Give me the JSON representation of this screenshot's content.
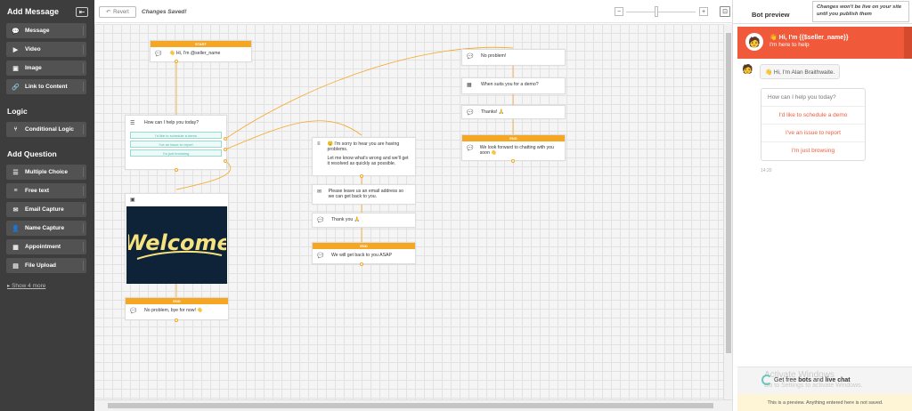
{
  "sidebar": {
    "add_message_title": "Add Message",
    "message_items": [
      {
        "label": "Message",
        "icon": "chat-icon"
      },
      {
        "label": "Video",
        "icon": "video-icon"
      },
      {
        "label": "Image",
        "icon": "image-icon"
      },
      {
        "label": "Link to Content",
        "icon": "link-icon"
      }
    ],
    "logic_title": "Logic",
    "logic_items": [
      {
        "label": "Conditional Logic",
        "icon": "branch-icon"
      }
    ],
    "add_question_title": "Add Question",
    "question_items": [
      {
        "label": "Multiple Choice",
        "icon": "list-icon"
      },
      {
        "label": "Free text",
        "icon": "text-icon"
      },
      {
        "label": "Email Capture",
        "icon": "envelope-icon"
      },
      {
        "label": "Name Capture",
        "icon": "user-icon"
      },
      {
        "label": "Appointment",
        "icon": "calendar-icon"
      },
      {
        "label": "File Upload",
        "icon": "file-icon"
      }
    ],
    "show_more": "Show 4 more"
  },
  "toolbar": {
    "revert_label": "Revert",
    "status": "Changes Saved!",
    "zoom_minus": "−",
    "zoom_plus": "+"
  },
  "flow": {
    "start_node": {
      "bar": "START",
      "text": "👋 Hi, I'm @seller_name"
    },
    "question_node": {
      "text": "How can I help you today?",
      "options": [
        "I'd like to schedule a demo",
        "I've an issue to report",
        "I'm just browsing"
      ]
    },
    "sorry_node": {
      "text1": "😟 I'm sorry to hear you are having problems.",
      "text2": "Let me know what's wrong and we'll get it resolved as quickly as possible."
    },
    "email_node": {
      "text": "Please leave us an email address so we can get back to you."
    },
    "thank_you_node": {
      "text": "Thank you 🙏"
    },
    "end_node_middle": {
      "bar": "END",
      "text": "We will get back to you ASAP"
    },
    "no_problem_node": {
      "text": "No problem!"
    },
    "when_suits_node": {
      "text": "When suits you for a demo?"
    },
    "thanks_node": {
      "text": "Thanks! 🙏"
    },
    "end_node_right": {
      "bar": "END",
      "text": "We look forward to chatting with you soon 👋"
    },
    "welcome_node": {
      "image_text": "Welcome"
    },
    "end_node_left": {
      "bar": "END",
      "text": "No problem, bye for now! 👋"
    }
  },
  "preview": {
    "title": "Bot preview",
    "note": "Changes won't be live on your site until you publish them",
    "banner_line1": "👋 Hi, I'm {{$seller_name}}",
    "banner_line2": "I'm here to help",
    "greeting": "👋 Hi, I'm Alan Braithwaite.",
    "question": "How can I help you today?",
    "options": [
      "I'd like to schedule a demo",
      "I've an issue to report",
      "I'm just browsing"
    ],
    "time": "14:20",
    "watermark_line1": "Activate Windows",
    "watermark_line2": "Go to Settings to activate Windows.",
    "free_bots_prefix": "Get free ",
    "free_bots_bold1": "bots",
    "free_bots_mid": " and ",
    "free_bots_bold2": "live chat",
    "footer": "This is a preview. Anything entered here is not saved."
  }
}
